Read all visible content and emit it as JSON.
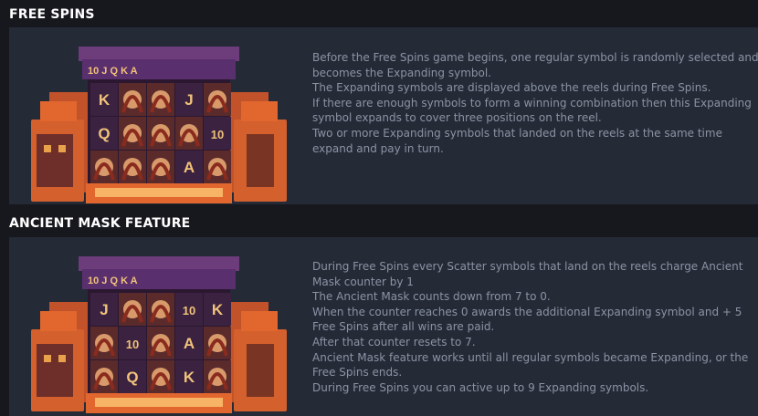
{
  "sections": [
    {
      "title": "FREE SPINS",
      "paytable_row": "10 J Q K A",
      "lines": [
        "Before the Free Spins game begins, one regular symbol is randomly selected and becomes the Expanding symbol.",
        "The Expanding symbols are displayed above the reels during Free Spins.",
        "If there are enough symbols to form a winning combination then this Expanding symbol expands to cover three positions on the reel.",
        "Two or more Expanding symbols that landed on the reels at the same time expand and pay in turn."
      ],
      "grid": [
        [
          "K",
          "W",
          "W",
          "J",
          "W"
        ],
        [
          "Q",
          "W",
          "W",
          "W",
          "10"
        ],
        [
          "W",
          "W",
          "W",
          "A",
          "W"
        ]
      ]
    },
    {
      "title": "ANCIENT MASK FEATURE",
      "paytable_row": "10 J Q K A",
      "lines": [
        "During Free Spins every Scatter symbols that land on the reels charge Ancient Mask counter by 1",
        "The Ancient Mask counts down from 7 to 0.",
        "When the counter reaches 0 awards the additional Expanding symbol and + 5 Free Spins after all wins are paid.",
        "After that counter resets to 7.",
        "Ancient Mask feature works until all regular symbols became Expanding, or the Free Spins ends.",
        "During Free Spins you can active up to 9 Expanding symbols."
      ],
      "grid": [
        [
          "J",
          "W",
          "W",
          "10",
          "K"
        ],
        [
          "W",
          "10",
          "W",
          "A",
          "W"
        ],
        [
          "W",
          "Q",
          "W",
          "K",
          "W"
        ]
      ]
    }
  ],
  "colors": {
    "background": "#17181d",
    "panel": "#252a37",
    "title": "#ffffff",
    "text": "#8b93a3",
    "temple_orange": "#e2672f",
    "temple_purple": "#5a2f6e",
    "symbol_gold": "#f0c27a"
  }
}
